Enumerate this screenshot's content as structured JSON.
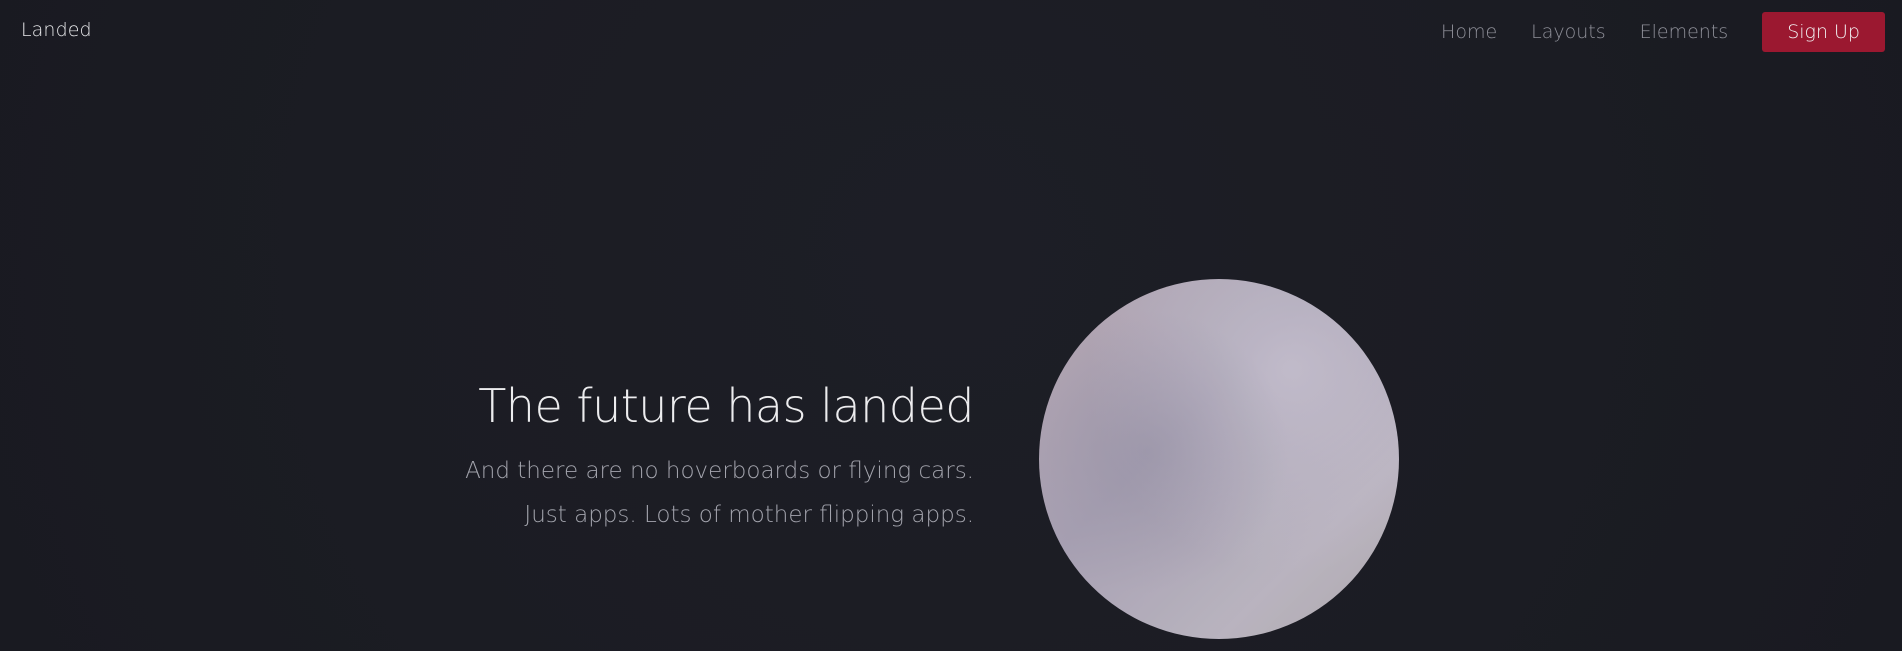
{
  "header": {
    "brand": "Landed",
    "nav": [
      {
        "label": "Home"
      },
      {
        "label": "Layouts"
      },
      {
        "label": "Elements"
      }
    ],
    "signup_label": "Sign Up"
  },
  "hero": {
    "title": "The future has landed",
    "subtitle_lines": [
      "And there are no hoverboards or flying cars.",
      "Just apps. Lots of mother flipping apps."
    ]
  },
  "colors": {
    "background": "#1c1d24",
    "accent": "#9b1830",
    "nav_text": "#8f9099"
  }
}
